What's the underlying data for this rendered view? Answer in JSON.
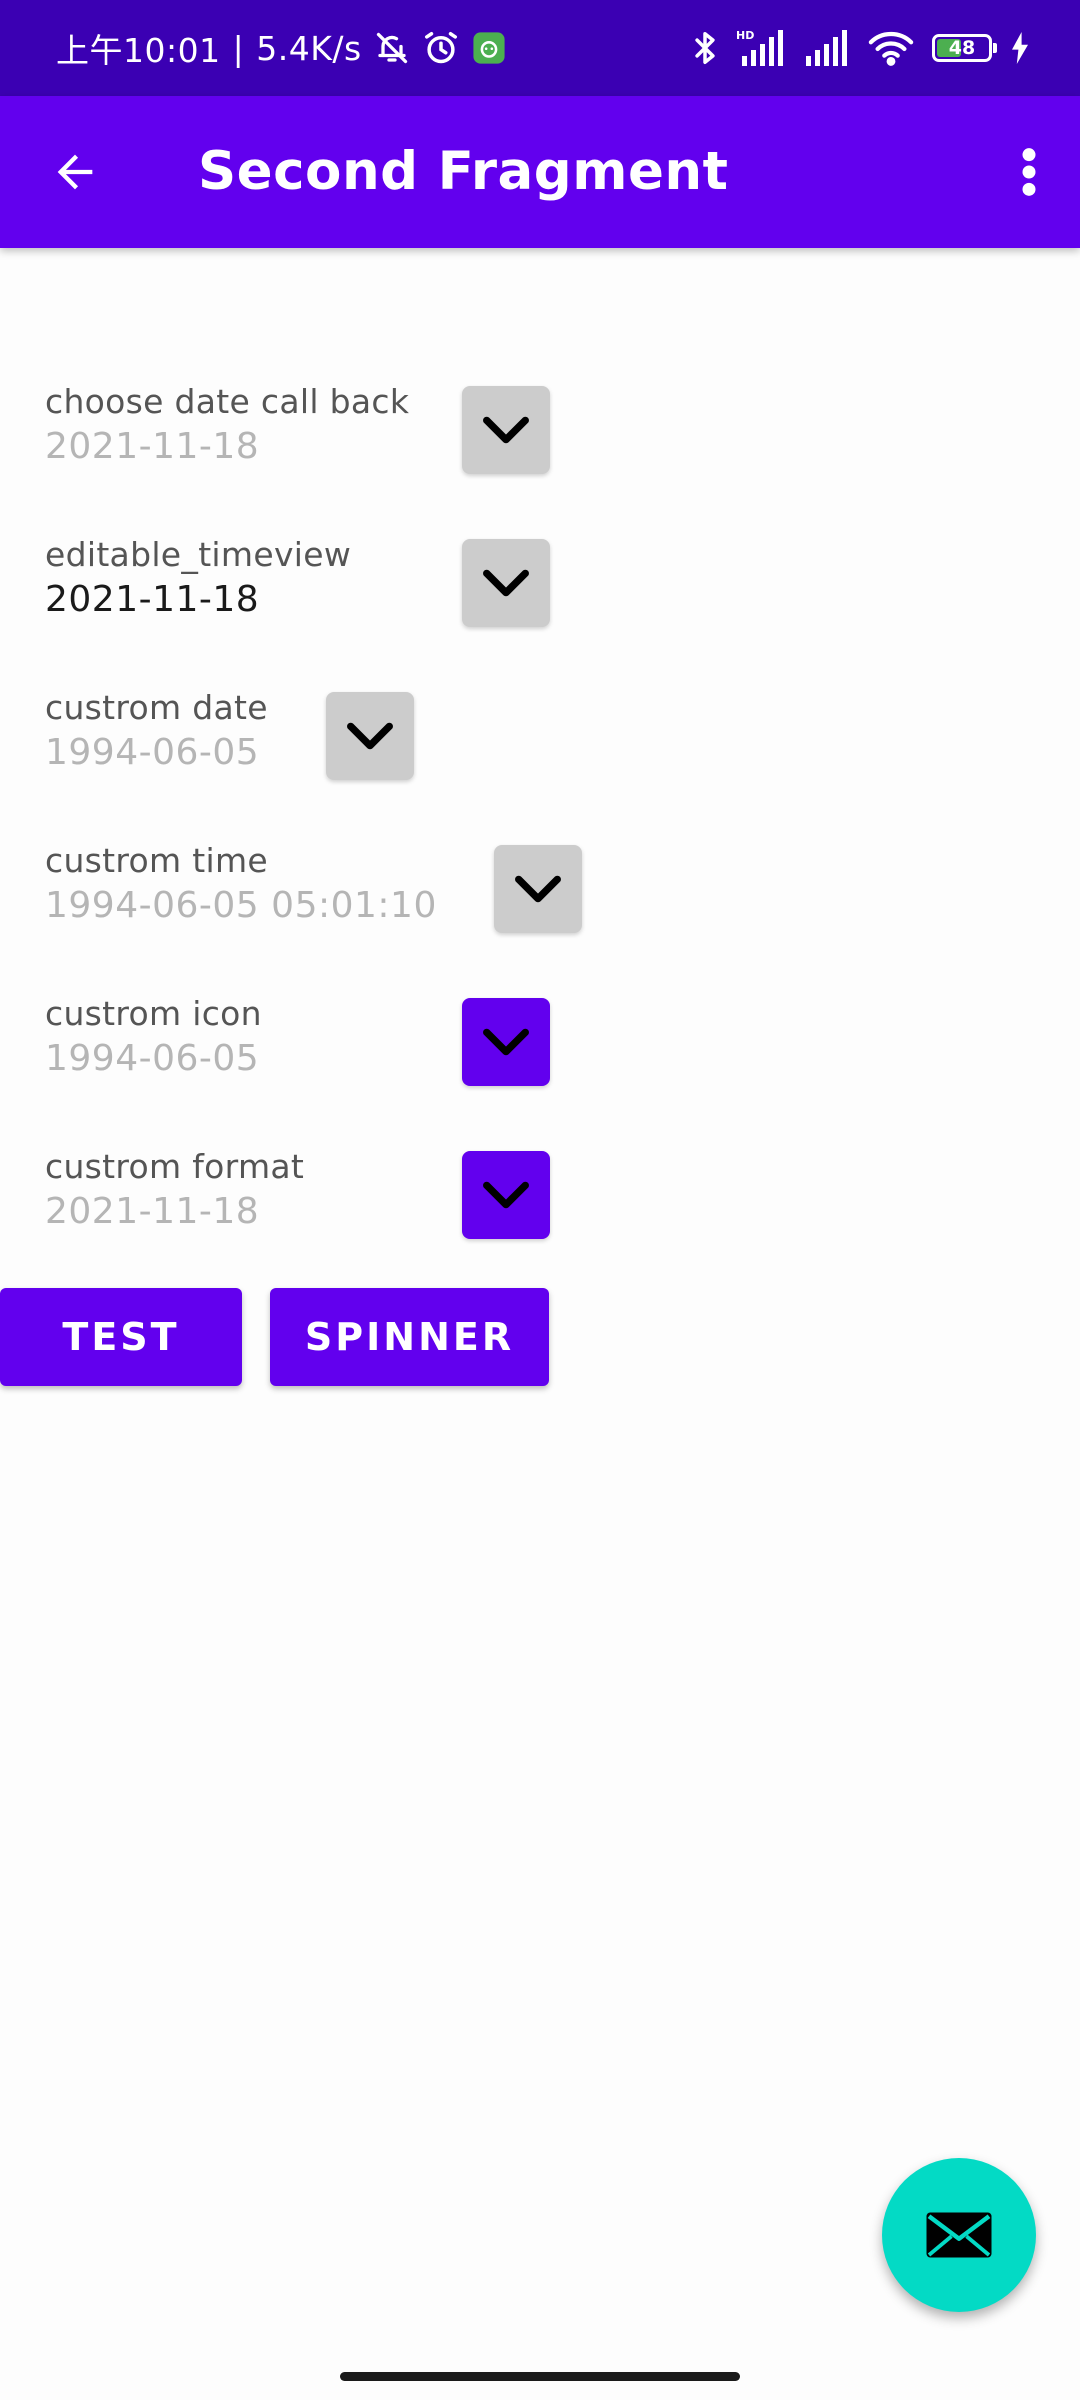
{
  "status_bar": {
    "time": "上午10:01",
    "separator": "|",
    "net_speed": "5.4K/s",
    "battery_level": "48",
    "icons": [
      "bell-off-icon",
      "alarm-icon",
      "app-notification-icon",
      "bluetooth-icon",
      "hd-signal-icon",
      "signal-icon",
      "wifi-icon",
      "battery-icon",
      "charging-icon"
    ]
  },
  "app_bar": {
    "title": "Second Fragment",
    "back_icon": "arrow-left-icon",
    "menu_icon": "more-vert-icon"
  },
  "rows": [
    {
      "label": "choose date call back",
      "value": "2021-11-18",
      "button_color": "#cccccc",
      "icon": "chevron-down-icon"
    },
    {
      "label": "editable_timeview",
      "value": "2021-11-18",
      "button_color": "#cccccc",
      "icon": "chevron-down-icon"
    },
    {
      "label": "custrom date",
      "value": "1994-06-05",
      "button_color": "#cccccc",
      "icon": "chevron-down-icon"
    },
    {
      "label": "custrom time",
      "value": "1994-06-05 05:01:10",
      "button_color": "#cccccc",
      "icon": "chevron-down-icon"
    },
    {
      "label": "custrom icon",
      "value": "1994-06-05",
      "button_color": "#6200ee",
      "icon": "chevron-down-icon"
    },
    {
      "label": "custrom format",
      "value": "2021-11-18",
      "button_color": "#6200ee",
      "icon": "chevron-down-icon"
    }
  ],
  "buttons": {
    "test_label": "TEST",
    "spinner_label": "SPINNER"
  },
  "fab": {
    "icon": "mail-icon",
    "color": "#03dac5"
  },
  "colors": {
    "primary": "#6200ee",
    "status_bar": "#3b00b3",
    "background": "#fdfdfd"
  }
}
